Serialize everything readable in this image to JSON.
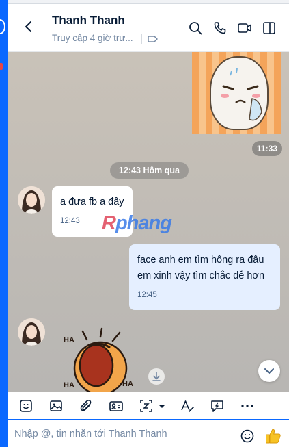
{
  "header": {
    "name": "Thanh Thanh",
    "status": "Truy cập 4 giờ trư..."
  },
  "chat": {
    "sticker_time": "11:33",
    "date_separator": "12:43 Hôm qua",
    "messages": [
      {
        "direction": "in",
        "text": "a đưa fb a đây",
        "time": "12:43"
      },
      {
        "direction": "out",
        "line1": "face anh em tìm hông ra đâu",
        "line2": "em xinh vậy tìm chắc dễ hơn",
        "time": "12:45"
      }
    ],
    "watermark": {
      "r": "R",
      "rest": "phang"
    }
  },
  "composer": {
    "placeholder": "Nhập @, tin nhắn tới Thanh Thanh"
  },
  "colors": {
    "accent": "#0a68ff",
    "bubble_in": "#ffffff",
    "bubble_out": "#e5efff",
    "name_text": "#081c36",
    "meta_text": "#7589a3"
  },
  "icons": {
    "header": [
      "back-icon",
      "search-icon",
      "phone-icon",
      "video-call-icon",
      "sidebar-toggle-icon"
    ],
    "toolbar": [
      "sticker-icon",
      "image-icon",
      "attachment-icon",
      "contact-card-icon",
      "screenshot-icon",
      "chevron-down-icon",
      "text-format-icon",
      "quick-message-icon",
      "more-icon"
    ]
  }
}
